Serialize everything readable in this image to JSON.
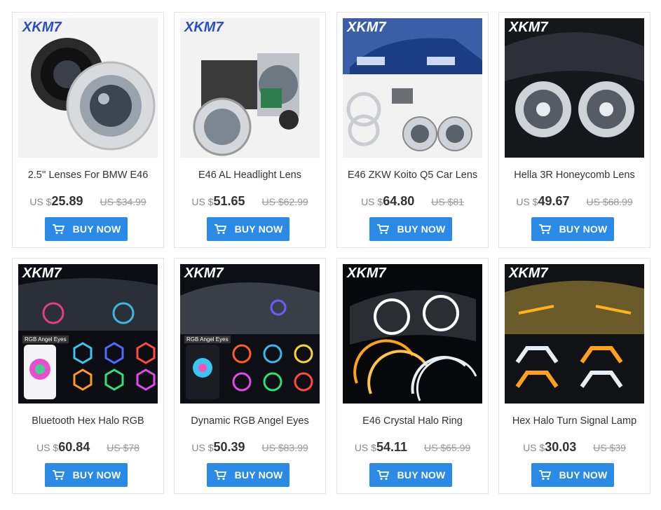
{
  "products": [
    {
      "title": "2.5'' Lenses For BMW E46",
      "currency": "US $",
      "price": "25.89",
      "old_price": "US $34.99",
      "button": "BUY NOW",
      "brand": "XKM7"
    },
    {
      "title": "E46 AL Headlight Lens",
      "currency": "US $",
      "price": "51.65",
      "old_price": "US $62.99",
      "button": "BUY NOW",
      "brand": "XKM7"
    },
    {
      "title": "E46 ZKW Koito Q5 Car Lens",
      "currency": "US $",
      "price": "64.80",
      "old_price": "US $81",
      "button": "BUY NOW",
      "brand": "XKM7"
    },
    {
      "title": "Hella 3R Honeycomb Lens",
      "currency": "US $",
      "price": "49.67",
      "old_price": "US $68.99",
      "button": "BUY NOW",
      "brand": "XKM7"
    },
    {
      "title": "Bluetooth Hex Halo RGB",
      "currency": "US $",
      "price": "60.84",
      "old_price": "US $78",
      "button": "BUY NOW",
      "brand": "XKM7",
      "badge": "RGB Angel Eyes"
    },
    {
      "title": "Dynamic RGB Angel Eyes",
      "currency": "US $",
      "price": "50.39",
      "old_price": "US $83.99",
      "button": "BUY NOW",
      "brand": "XKM7",
      "badge": "RGB Angel Eyes"
    },
    {
      "title": "E46 Crystal Halo Ring",
      "currency": "US $",
      "price": "54.11",
      "old_price": "US $65.99",
      "button": "BUY NOW",
      "brand": "XKM7"
    },
    {
      "title": "Hex Halo Turn Signal Lamp",
      "currency": "US $",
      "price": "30.03",
      "old_price": "US $39",
      "button": "BUY NOW",
      "brand": "XKM7"
    }
  ],
  "colors": {
    "button": "#2b8ae6",
    "brand_text": "#2a4fbf",
    "title": "#333333",
    "strike": "#999999"
  }
}
